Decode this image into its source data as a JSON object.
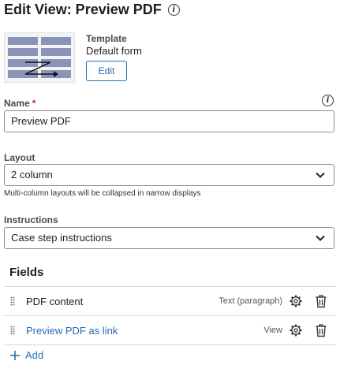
{
  "header": {
    "title": "Edit View: Preview PDF"
  },
  "template": {
    "label": "Template",
    "value": "Default form",
    "edit_label": "Edit"
  },
  "name": {
    "label": "Name",
    "required_mark": "*",
    "value": "Preview PDF"
  },
  "layout": {
    "label": "Layout",
    "value": "2 column",
    "helper": "Multi-column layouts will be collapsed in narrow displays"
  },
  "instructions": {
    "label": "Instructions",
    "value": "Case step instructions"
  },
  "fields": {
    "title": "Fields",
    "rows": [
      {
        "label": "PDF content",
        "type": "Text (paragraph)"
      },
      {
        "label": "Preview PDF as link",
        "type": "View"
      }
    ],
    "add_label": "Add"
  },
  "colors": {
    "link": "#2a6bb5",
    "required": "#c62828",
    "thumb_bar": "#8a93b8"
  },
  "icons": [
    "info-icon",
    "chevron-down-icon",
    "drag-handle-icon",
    "gear-icon",
    "trash-icon",
    "plus-icon"
  ]
}
